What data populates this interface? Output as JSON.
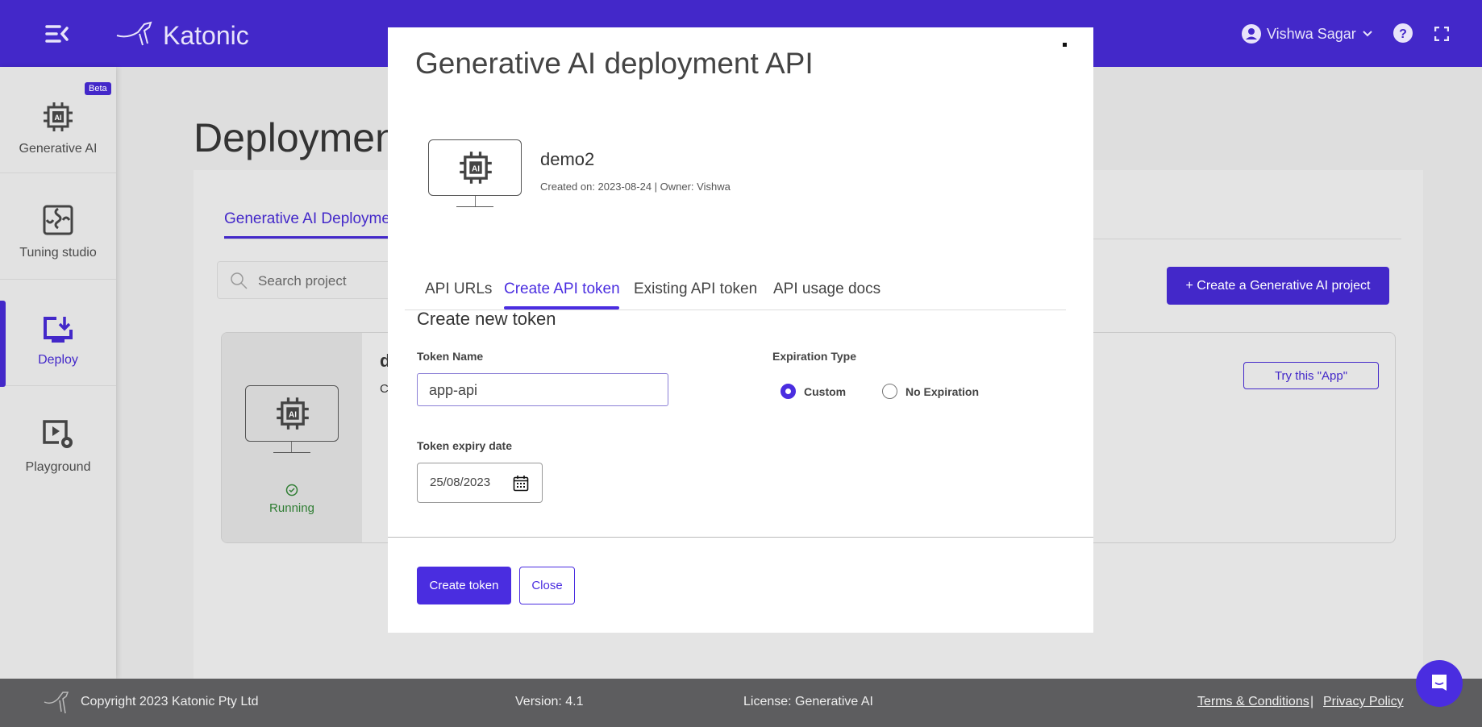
{
  "header": {
    "brand": "Katonic",
    "user_name": "Vishwa Sagar",
    "icons": [
      "menu-collapse-icon",
      "user-avatar-icon",
      "chevron-down-icon",
      "help-icon",
      "fullscreen-icon"
    ]
  },
  "sidebar": {
    "items": [
      {
        "label": "Generative AI",
        "badge": "Beta",
        "icon": "ai-chip-icon"
      },
      {
        "label": "Tuning studio",
        "icon": "puzzle-icon"
      },
      {
        "label": "Deploy",
        "icon": "deploy-icon",
        "active": true
      },
      {
        "label": "Playground",
        "icon": "playground-icon"
      }
    ]
  },
  "page": {
    "title": "Deploymen",
    "tab": "Generative AI Deployme",
    "search_placeholder": "Search project",
    "create_project_label": "+ Create a Generative AI project",
    "card": {
      "name_partial": "d",
      "created_partial": "C",
      "status": "Running",
      "try_app_label": "Try this \"App\""
    }
  },
  "modal": {
    "title": "Generative AI deployment API",
    "project": {
      "name": "demo2",
      "meta": "Created on: 2023-08-24 | Owner: Vishwa"
    },
    "tabs": [
      {
        "label": "API URLs"
      },
      {
        "label": "Create API token",
        "active": true
      },
      {
        "label": "Existing API token"
      },
      {
        "label": "API usage docs"
      }
    ],
    "section_title": "Create new token",
    "token_name_label": "Token Name",
    "token_name_value": "app-api",
    "expiration_label": "Expiration Type",
    "expiration_options": [
      {
        "label": "Custom",
        "selected": true
      },
      {
        "label": "No Expiration",
        "selected": false
      }
    ],
    "expiry_date_label": "Token expiry date",
    "expiry_date_value": "25/08/2023",
    "create_label": "Create token",
    "close_label": "Close"
  },
  "footer": {
    "copyright": "Copyright 2023 Katonic Pty Ltd",
    "version": "Version: 4.1",
    "license": "License: Generative AI",
    "terms": "Terms & Conditions",
    "separator": "|",
    "privacy": "Privacy Policy"
  },
  "colors": {
    "brand": "#4a2de0",
    "header": "#4328c9",
    "running": "#2e7d32"
  }
}
